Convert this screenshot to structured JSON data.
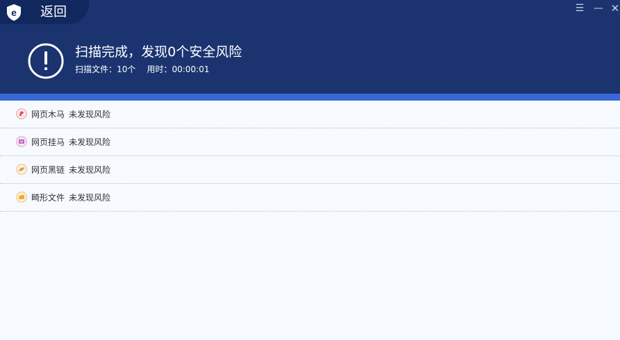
{
  "window": {
    "back_label": "返回",
    "logo_icon": "shield-e-logo",
    "buttons": {
      "menu_icon": "menu-icon",
      "minimize_icon": "minimize-icon",
      "close_icon": "close-icon"
    }
  },
  "result": {
    "title": "扫描完成，发现0个安全风险",
    "files_label": "扫描文件：",
    "files_value": "10个",
    "time_label": "用时：",
    "time_value": "00:00:01"
  },
  "colors": {
    "header_bg": "#1b3470",
    "tab_bg": "#11285f",
    "accent_bar": "#3969d6",
    "content_bg": "#f6f9fe"
  },
  "items": [
    {
      "name": "网页木马",
      "status": "未发现风险",
      "icon": "trojan-icon"
    },
    {
      "name": "网页挂马",
      "status": "未发现风险",
      "icon": "hanging-horse-icon"
    },
    {
      "name": "网页黑链",
      "status": "未发现风险",
      "icon": "black-link-icon"
    },
    {
      "name": "畸形文件",
      "status": "未发现风险",
      "icon": "malformed-file-icon"
    }
  ]
}
